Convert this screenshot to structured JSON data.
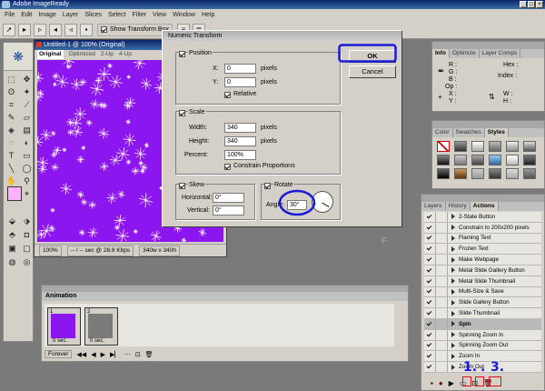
{
  "app": {
    "title": "Adobe ImageReady"
  },
  "menu": [
    "File",
    "Edit",
    "Image",
    "Layer",
    "Slices",
    "Select",
    "Filter",
    "View",
    "Window",
    "Help"
  ],
  "options_bar": {
    "show_transform_label": "Show Transform Box"
  },
  "document": {
    "title": "Untitled-1 @ 100% (Original)",
    "tabs": [
      "Original",
      "Optimized",
      "2-Up",
      "4-Up"
    ],
    "zoom": "100%",
    "download": "-- / -- sec @ 28.8 Kbps",
    "size": "340w x 340h"
  },
  "dialog": {
    "title": "Numeric Transform",
    "ok": "OK",
    "cancel": "Cancel",
    "position": {
      "label": "Position",
      "x_label": "X:",
      "x_value": "0",
      "y_label": "Y:",
      "y_value": "0",
      "unit": "pixels",
      "relative": "Relative"
    },
    "scale": {
      "label": "Scale",
      "width_label": "Width:",
      "width": "340",
      "height_label": "Height:",
      "height": "340",
      "unit": "pixels",
      "percent_label": "Percent:",
      "percent": "100%",
      "constrain": "Constrain Proportions"
    },
    "skew": {
      "label": "Skew",
      "h_label": "Horizontal:",
      "h_value": "0°",
      "v_label": "Vertical:",
      "v_value": "0°"
    },
    "rotate": {
      "label": "Rotate",
      "angle_label": "Angle:",
      "angle": "30°"
    }
  },
  "info_panel": {
    "tabs": [
      "Info",
      "Optimize",
      "Layer Comps"
    ],
    "r": "R :",
    "g": "G :",
    "b": "B :",
    "op": "Op :",
    "hex": "Hex :",
    "index": "Index :",
    "x": "X :",
    "y": "Y :",
    "w": "W :",
    "h": "H :"
  },
  "styles_panel": {
    "tabs": [
      "Color",
      "Swatches",
      "Styles"
    ]
  },
  "animation_panel": {
    "title": "Animation",
    "frames": [
      {
        "num": "1",
        "delay": "0 sec."
      },
      {
        "num": "2",
        "delay": "0 sec."
      }
    ],
    "loop": "Forever"
  },
  "actions_panel": {
    "tabs": [
      "Layers",
      "History",
      "Actions"
    ],
    "items": [
      {
        "label": "2-State Button",
        "selected": false
      },
      {
        "label": "Constrain to 200x200 pixels",
        "selected": false
      },
      {
        "label": "Flaming Text",
        "selected": false
      },
      {
        "label": "Frozen Text",
        "selected": false
      },
      {
        "label": "Make Webpage",
        "selected": false
      },
      {
        "label": "Metal Slide Gallery Button",
        "selected": false
      },
      {
        "label": "Metal Slide Thumbnail",
        "selected": false
      },
      {
        "label": "Multi-Size & Save",
        "selected": false
      },
      {
        "label": "Slide Gallery Button",
        "selected": false
      },
      {
        "label": "Slide Thumbnail",
        "selected": false
      },
      {
        "label": "Spin",
        "selected": true
      },
      {
        "label": "Spinning Zoom In",
        "selected": false
      },
      {
        "label": "Spinning Zoom Out",
        "selected": false
      },
      {
        "label": "Zoom In",
        "selected": false
      },
      {
        "label": "Zoom Out",
        "selected": false
      }
    ]
  },
  "annotations": {
    "one": "1.",
    "dot": ".",
    "three": "3.",
    "F": "F"
  },
  "colors": {
    "canvas": "#8b16f0",
    "annotation": "#1a1ad8",
    "highlight_red": "#e01010"
  }
}
